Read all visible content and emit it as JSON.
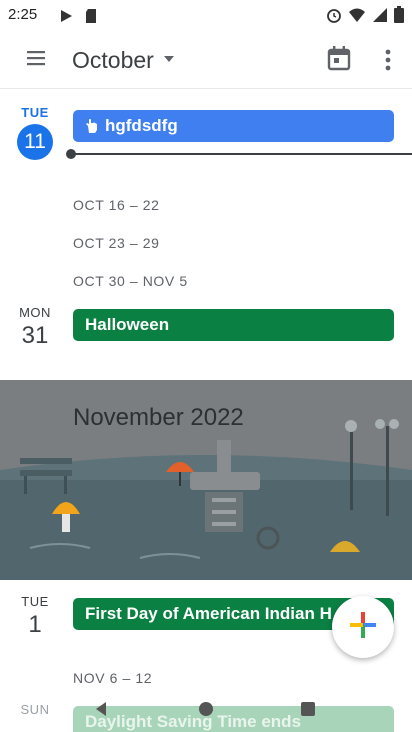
{
  "status_bar": {
    "time": "2:25",
    "icons": [
      "play-protect-icon",
      "sd-card-icon",
      "alarm-icon",
      "wifi-icon",
      "signal-icon",
      "battery-icon"
    ]
  },
  "app_bar": {
    "menu_icon": "hamburger-menu-icon",
    "month": "October",
    "dropdown_icon": "caret-down-icon",
    "today_icon": "calendar-today-icon",
    "overflow_icon": "more-vert-icon"
  },
  "days": [
    {
      "dow": "TUE",
      "date": "11",
      "today": true,
      "event": "hgfdsdfg",
      "event_color": "#3f7ff0",
      "event_icon": "hand-icon"
    },
    {
      "dow": "MON",
      "date": "31",
      "today": false,
      "event": "Halloween",
      "event_color": "#0b8043"
    },
    {
      "dow": "TUE",
      "date": "1",
      "today": false,
      "event": "First Day of American Indian H",
      "event_color": "#0b8043"
    },
    {
      "dow": "SUN",
      "date": "",
      "today": false,
      "event": "Daylight Saving Time ends",
      "event_color": "#0b8043"
    }
  ],
  "week_ranges": [
    "OCT 16 – 22",
    "OCT 23 – 29",
    "OCT 30 – NOV 5",
    "NOV 6 – 12"
  ],
  "month_banner": {
    "title": "November 2022"
  },
  "fab": {
    "icon": "add-icon"
  },
  "nav_bar": {
    "back_icon": "back-icon",
    "home_icon": "home-icon",
    "recents_icon": "recents-icon"
  },
  "colors": {
    "accent": "#1a73e8",
    "event_blue": "#3f7ff0",
    "event_green": "#0b8043"
  }
}
